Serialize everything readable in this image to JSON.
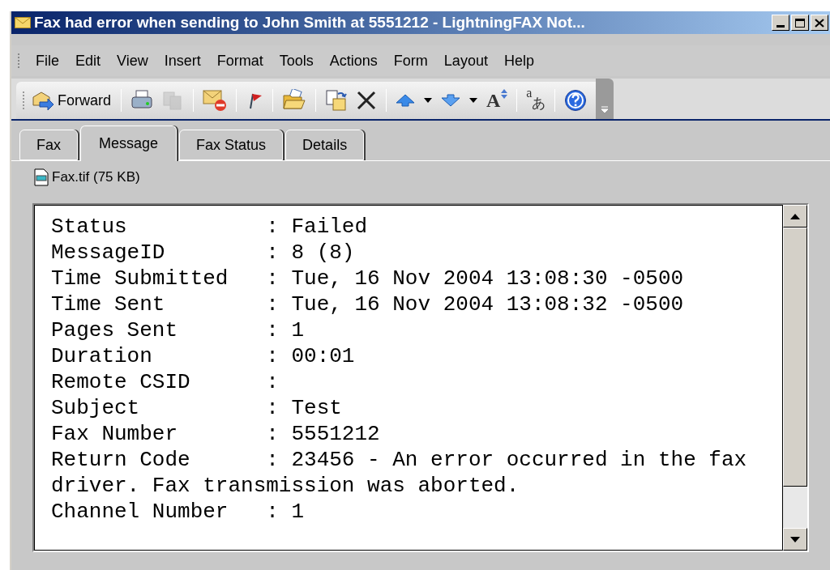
{
  "window": {
    "title": "Fax had error when sending to John Smith at 5551212 - LightningFAX Not..."
  },
  "menu": [
    "File",
    "Edit",
    "View",
    "Insert",
    "Format",
    "Tools",
    "Actions",
    "Form",
    "Layout",
    "Help"
  ],
  "toolbar": [
    {
      "kind": "button",
      "label": "Forward"
    },
    {
      "kind": "separator"
    },
    {
      "kind": "icon",
      "disabled": false
    },
    {
      "kind": "icon",
      "disabled": true
    },
    {
      "kind": "separator"
    },
    {
      "kind": "icon",
      "disabled": false
    },
    {
      "kind": "separator"
    },
    {
      "kind": "icon",
      "disabled": false
    },
    {
      "kind": "separator"
    },
    {
      "kind": "icon",
      "disabled": false
    },
    {
      "kind": "separator"
    },
    {
      "kind": "icon",
      "disabled": false
    },
    {
      "kind": "icon",
      "disabled": false
    },
    {
      "kind": "separator"
    },
    {
      "kind": "icon",
      "disabled": false
    },
    {
      "kind": "dropdown"
    },
    {
      "kind": "icon",
      "disabled": false
    },
    {
      "kind": "dropdown"
    },
    {
      "kind": "glyph",
      "glyph": "A"
    },
    {
      "kind": "separator"
    },
    {
      "kind": "glyph2",
      "glyph": "a",
      "glyph2": "あ"
    },
    {
      "kind": "separator"
    },
    {
      "kind": "icon",
      "disabled": false
    }
  ],
  "tabs": [
    {
      "label": "Fax",
      "selected": false
    },
    {
      "label": "Message",
      "selected": true
    },
    {
      "label": "Fax Status",
      "selected": false
    },
    {
      "label": "Details",
      "selected": false
    }
  ],
  "attachment": {
    "name": "Fax.tif (75 KB)"
  },
  "message": [
    {
      "label": "Status",
      "value": ": Failed"
    },
    {
      "label": "MessageID",
      "value": ": 8 (8)"
    },
    {
      "label": "Time Submitted",
      "value": ": Tue, 16 Nov 2004 13:08:30 -0500"
    },
    {
      "label": "Time Sent",
      "value": ": Tue, 16 Nov 2004 13:08:32 -0500"
    },
    {
      "label": "Pages Sent",
      "value": ": 1"
    },
    {
      "label": "Duration",
      "value": ": 00:01"
    },
    {
      "label": "Remote CSID",
      "value": ":"
    },
    {
      "label": "Subject",
      "value": ": Test"
    },
    {
      "label": "Fax Number",
      "value": ": 5551212"
    },
    {
      "label": "Return Code",
      "value": ": 23456 - An error occurred in the fax driver. Fax transmission was aborted."
    },
    {
      "label": "Channel Number",
      "value": ": 1"
    }
  ]
}
